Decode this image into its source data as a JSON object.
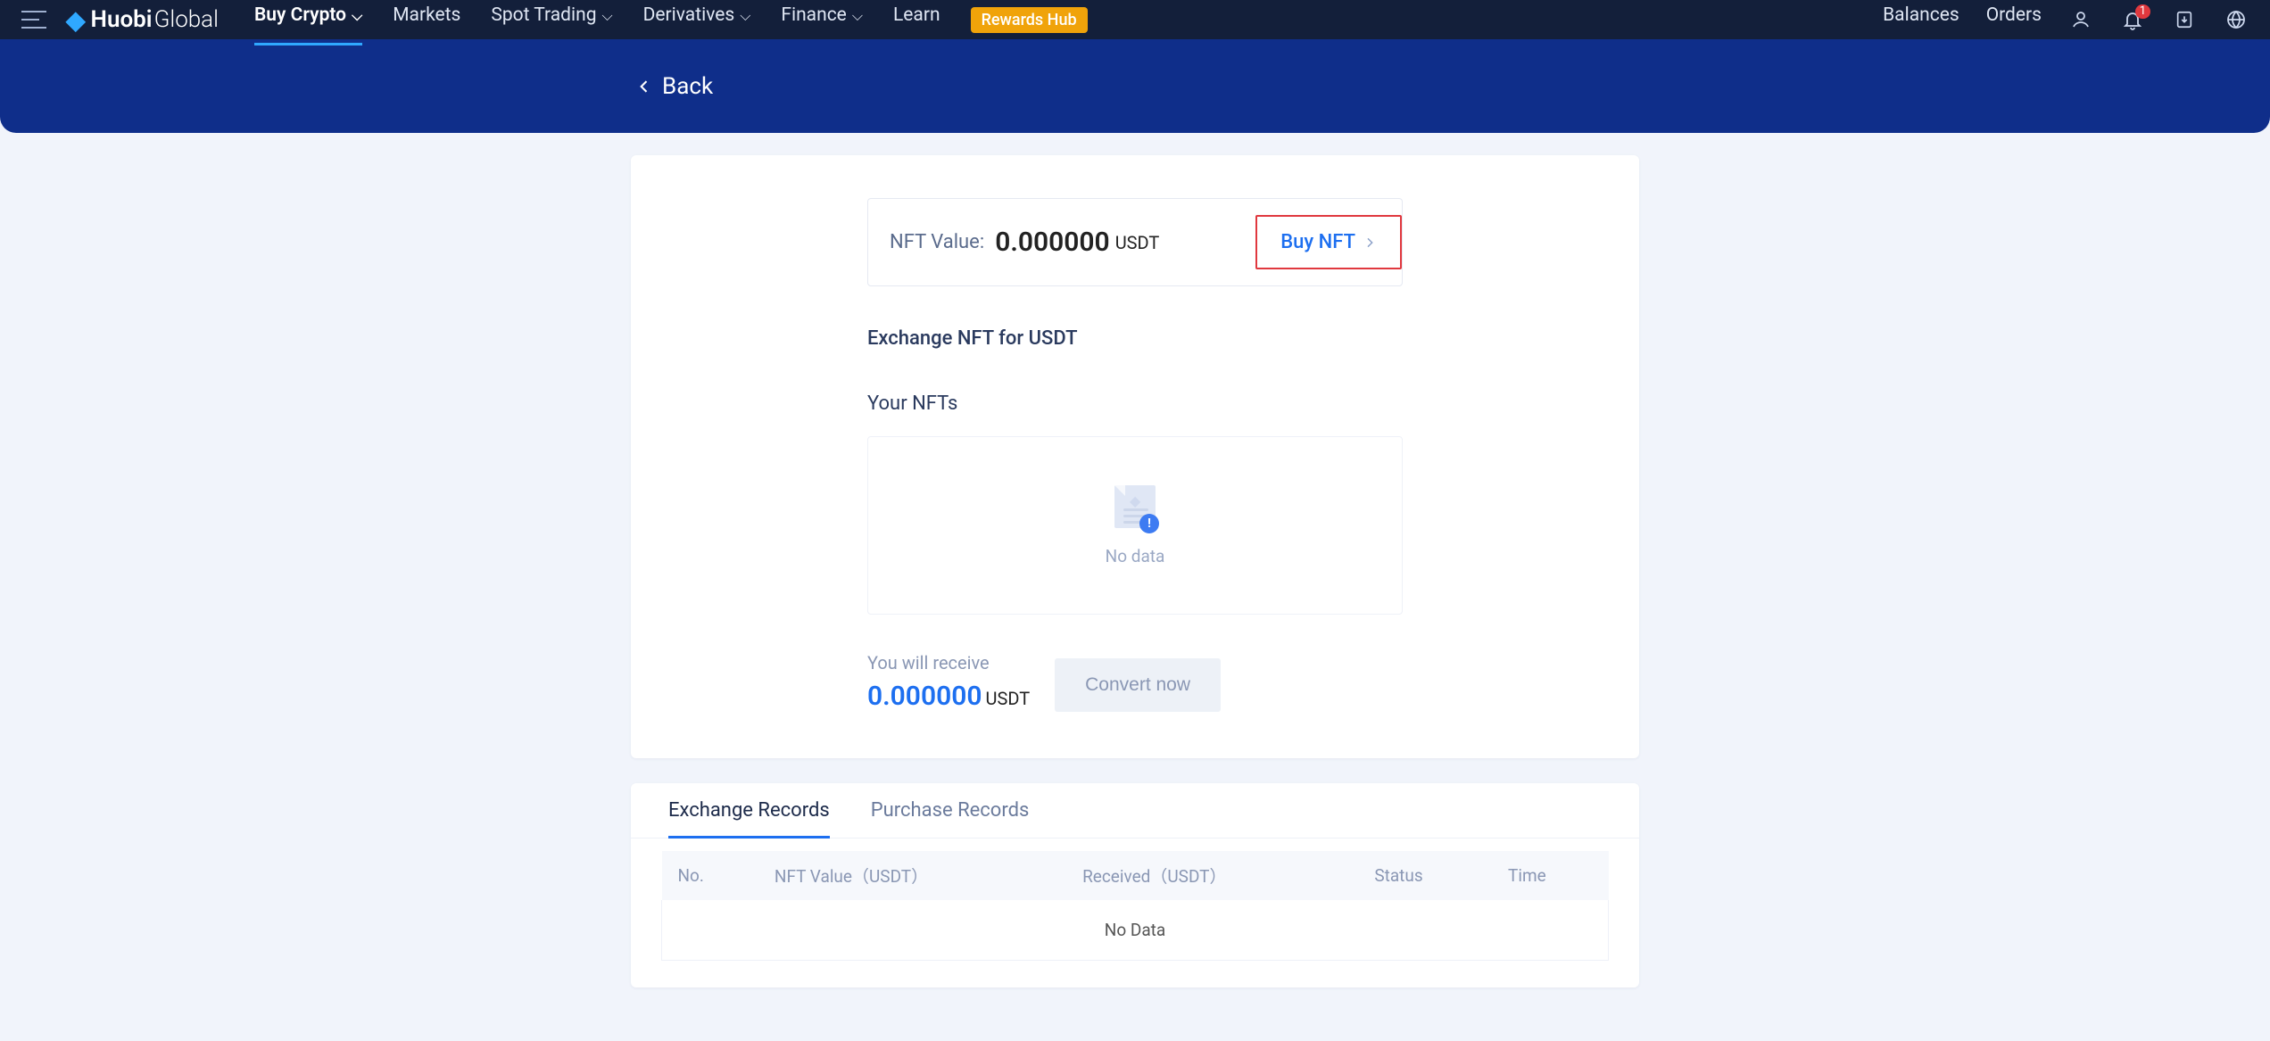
{
  "brand": {
    "name1": "Huobi",
    "name2": "Global"
  },
  "nav": {
    "buy_crypto": "Buy Crypto",
    "markets": "Markets",
    "spot_trading": "Spot Trading",
    "derivatives": "Derivatives",
    "finance": "Finance",
    "learn": "Learn",
    "rewards": "Rewards Hub",
    "balances": "Balances",
    "orders": "Orders"
  },
  "bell_badge": "1",
  "back": {
    "label": "Back"
  },
  "nft": {
    "value_label": "NFT Value:",
    "value_amount": "0.000000",
    "value_unit": "USDT",
    "buy_label": "Buy NFT"
  },
  "exchange_heading": "Exchange NFT for USDT",
  "your_nfts_heading": "Your NFTs",
  "empty_nfts": "No data",
  "receive": {
    "label": "You will receive",
    "amount": "0.000000",
    "unit": "USDT",
    "button": "Convert now"
  },
  "tabs": {
    "exchange": "Exchange Records",
    "purchase": "Purchase Records"
  },
  "table": {
    "cols": {
      "no": "No.",
      "nft_value": "NFT Value（USDT）",
      "received": "Received（USDT）",
      "status": "Status",
      "time": "Time"
    },
    "empty": "No Data"
  }
}
